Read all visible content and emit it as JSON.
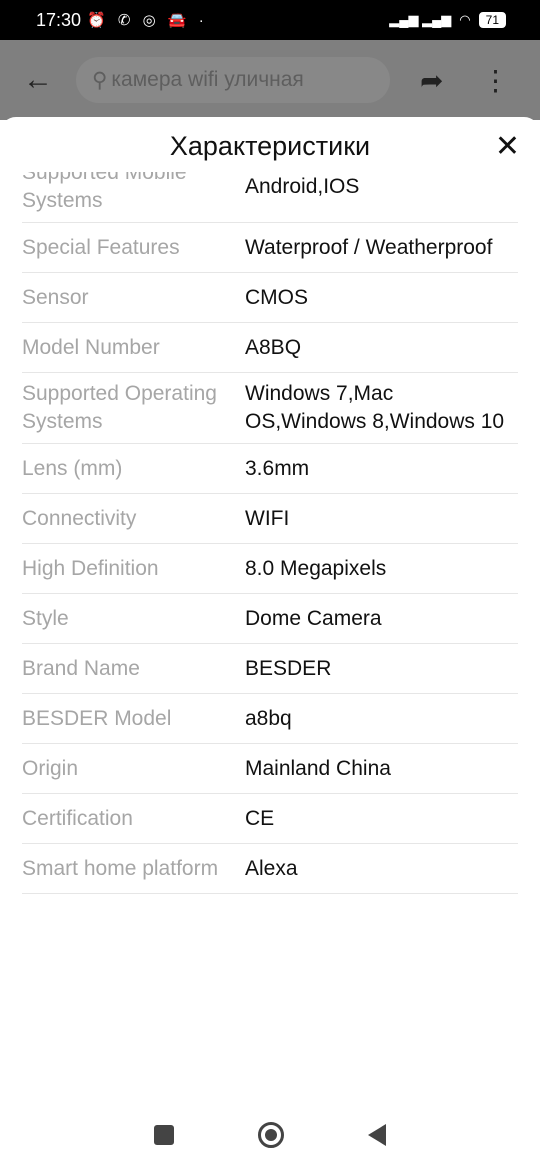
{
  "status": {
    "time": "17:30",
    "icons": "⏰ ✆ ◎ 🚘 ·",
    "battery": "71"
  },
  "appbar": {
    "search_placeholder": "камера wifi уличная"
  },
  "sheet": {
    "title": "Характеристики",
    "rows": [
      {
        "label": "Supported Mobile Systems",
        "value": "Android,IOS"
      },
      {
        "label": "Special Features",
        "value": "Waterproof / Weatherproof"
      },
      {
        "label": "Sensor",
        "value": "CMOS"
      },
      {
        "label": "Model Number",
        "value": "A8BQ"
      },
      {
        "label": "Supported Operating Systems",
        "value": "Windows 7,Mac OS,Windows 8,Windows 10"
      },
      {
        "label": "Lens (mm)",
        "value": "3.6mm"
      },
      {
        "label": "Connectivity",
        "value": "WIFI"
      },
      {
        "label": "High Definition",
        "value": "8.0 Megapixels"
      },
      {
        "label": "Style",
        "value": "Dome Camera"
      },
      {
        "label": "Brand Name",
        "value": "BESDER"
      },
      {
        "label": "BESDER Model",
        "value": "a8bq"
      },
      {
        "label": "Origin",
        "value": "Mainland China"
      },
      {
        "label": "Certification",
        "value": "CE"
      },
      {
        "label": "Smart home platform",
        "value": "Alexa"
      }
    ]
  }
}
